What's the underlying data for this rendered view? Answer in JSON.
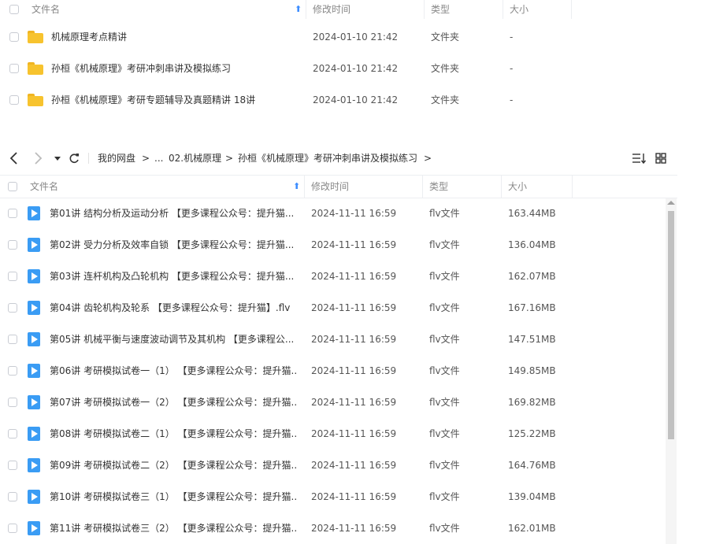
{
  "top_table": {
    "headers": {
      "name": "文件名",
      "mtime": "修改时间",
      "type": "类型",
      "size": "大小"
    },
    "rows": [
      {
        "name": "机械原理考点精讲",
        "mtime": "2024-01-10 21:42",
        "type": "文件夹",
        "size": "-"
      },
      {
        "name": "孙桓《机械原理》考研冲刺串讲及模拟练习",
        "mtime": "2024-01-10 21:42",
        "type": "文件夹",
        "size": "-"
      },
      {
        "name": "孙桓《机械原理》考研专题辅导及真题精讲 18讲",
        "mtime": "2024-01-10 21:42",
        "type": "文件夹",
        "size": "-"
      }
    ]
  },
  "toolbar": {
    "back_icon": "chevron-left-icon",
    "forward_icon": "chevron-right-icon",
    "history_icon": "caret-down-icon",
    "refresh_icon": "refresh-icon",
    "breadcrumb": [
      "我的网盘",
      "...",
      "02.机械原理",
      "孙桓《机械原理》考研冲刺串讲及模拟练习"
    ],
    "sort_icon": "sort-icon",
    "grid_icon": "grid-view-icon"
  },
  "bottom_table": {
    "headers": {
      "name": "文件名",
      "mtime": "修改时间",
      "type": "类型",
      "size": "大小"
    },
    "rows": [
      {
        "name": "第01讲 结构分析及运动分析 【更多课程公众号：提升猫...",
        "mtime": "2024-11-11 16:59",
        "type": "flv文件",
        "size": "163.44MB"
      },
      {
        "name": "第02讲 受力分析及效率自锁 【更多课程公众号：提升猫...",
        "mtime": "2024-11-11 16:59",
        "type": "flv文件",
        "size": "136.04MB"
      },
      {
        "name": "第03讲 连杆机构及凸轮机构 【更多课程公众号：提升猫...",
        "mtime": "2024-11-11 16:59",
        "type": "flv文件",
        "size": "162.07MB"
      },
      {
        "name": "第04讲 齿轮机构及轮系 【更多课程公众号：提升猫】.flv",
        "mtime": "2024-11-11 16:59",
        "type": "flv文件",
        "size": "167.16MB"
      },
      {
        "name": "第05讲 机械平衡与速度波动调节及其机构 【更多课程公...",
        "mtime": "2024-11-11 16:59",
        "type": "flv文件",
        "size": "147.51MB"
      },
      {
        "name": "第06讲 考研模拟试卷一（1） 【更多课程公众号：提升猫...",
        "mtime": "2024-11-11 16:59",
        "type": "flv文件",
        "size": "149.85MB"
      },
      {
        "name": "第07讲 考研模拟试卷一（2） 【更多课程公众号：提升猫...",
        "mtime": "2024-11-11 16:59",
        "type": "flv文件",
        "size": "169.82MB"
      },
      {
        "name": "第08讲 考研模拟试卷二（1） 【更多课程公众号：提升猫...",
        "mtime": "2024-11-11 16:59",
        "type": "flv文件",
        "size": "125.22MB"
      },
      {
        "name": "第09讲 考研模拟试卷二（2） 【更多课程公众号：提升猫...",
        "mtime": "2024-11-11 16:59",
        "type": "flv文件",
        "size": "164.76MB"
      },
      {
        "name": "第10讲 考研模拟试卷三（1） 【更多课程公众号：提升猫...",
        "mtime": "2024-11-11 16:59",
        "type": "flv文件",
        "size": "139.04MB"
      },
      {
        "name": "第11讲 考研模拟试卷三（2） 【更多课程公众号：提升猫...",
        "mtime": "2024-11-11 16:59",
        "type": "flv文件",
        "size": "162.01MB"
      }
    ]
  },
  "colors": {
    "accent": "#3b8cff",
    "folder": "#f7c32e",
    "video": "#3a9cf4"
  }
}
